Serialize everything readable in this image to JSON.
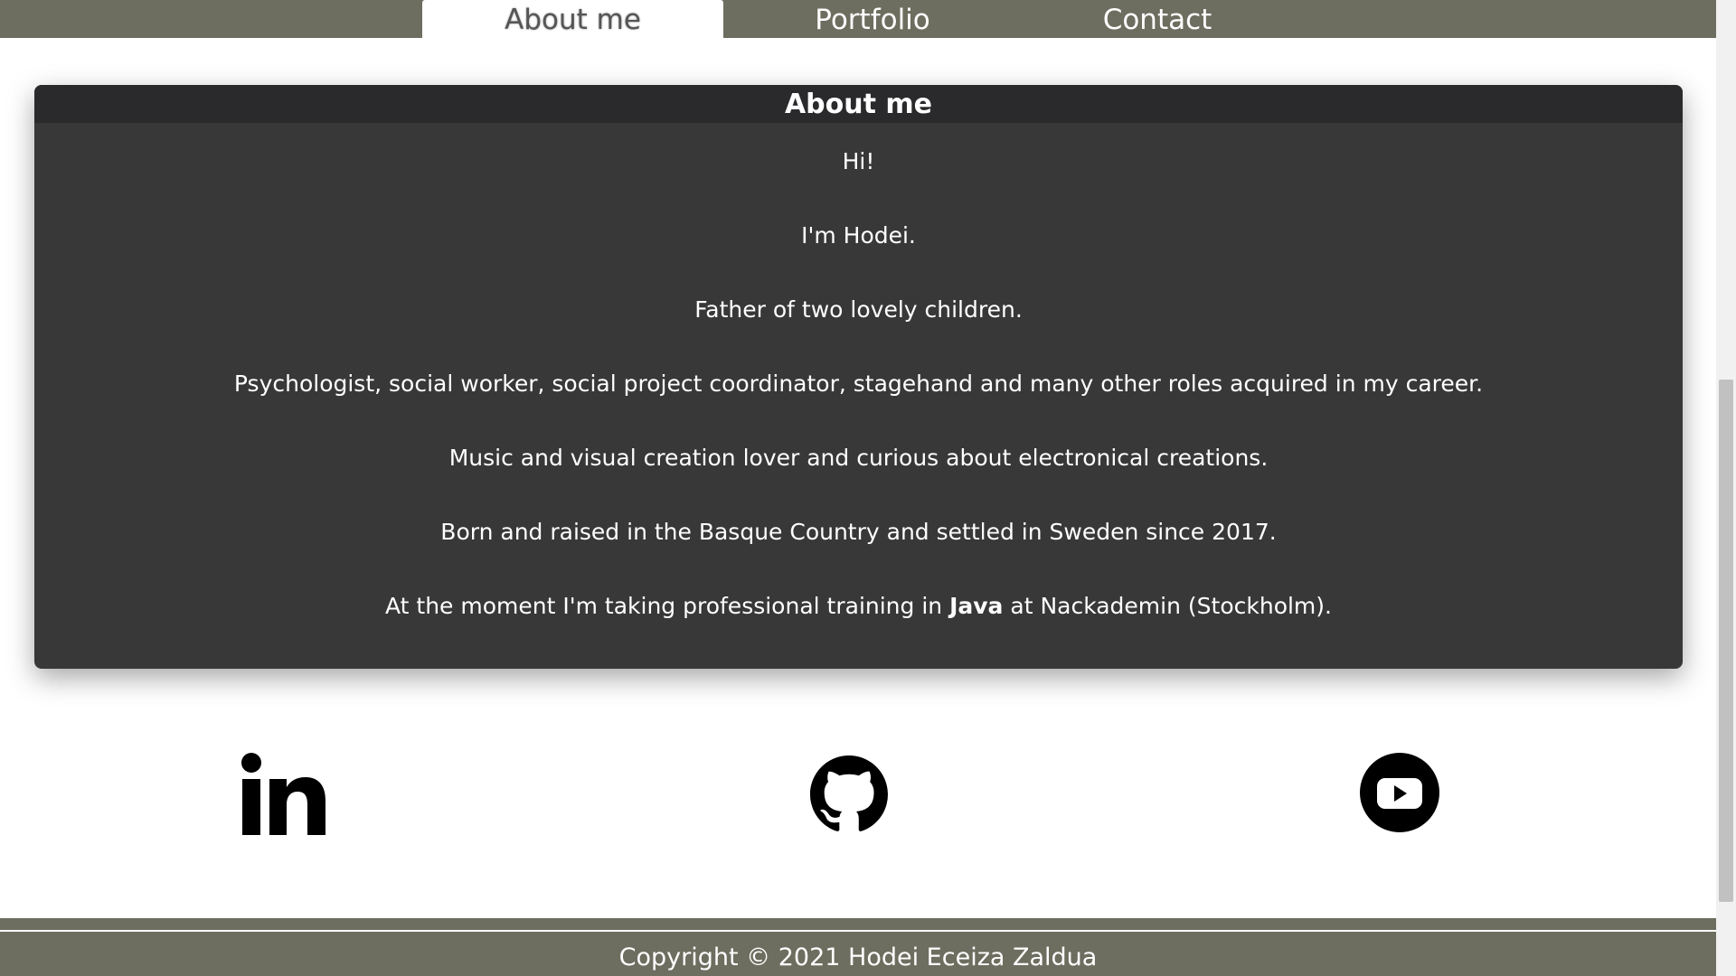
{
  "nav": {
    "tabs": [
      {
        "label": "About me",
        "active": true
      },
      {
        "label": "Portfolio",
        "active": false
      },
      {
        "label": "Contact",
        "active": false
      }
    ]
  },
  "about": {
    "title": "About me",
    "paragraphs": [
      "Hi!",
      "I'm Hodei.",
      "Father of two lovely children.",
      "Psychologist, social worker, social project coordinator, stagehand and many other roles acquired in my career.",
      "Music and visual creation lover and curious about electronical creations.",
      "Born and raised in the Basque Country and settled in Sweden since 2017."
    ],
    "last_paragraph": {
      "before": "At the moment I'm taking professional training in ",
      "bold": "Java",
      "after": " at Nackademin (Stockholm)."
    }
  },
  "social": {
    "icons": [
      "linkedin-icon",
      "github-icon",
      "youtube-icon"
    ]
  },
  "footer": {
    "copyright": "Copyright © 2021 Hodei Eceiza Zaldua"
  },
  "colors": {
    "nav_bg": "#6d6e5f",
    "card_bg": "#383838",
    "card_header_bg": "#2a2a2d",
    "footer_bg": "#6d6e5f"
  }
}
